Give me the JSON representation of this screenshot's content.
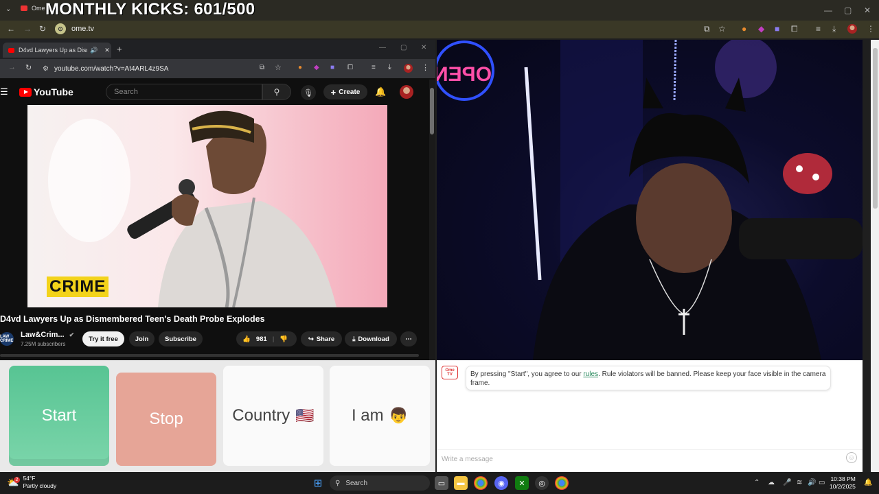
{
  "overlay_banner": "MONTHLY KICKS: 601/500",
  "outer_browser": {
    "tab_title": "Ome",
    "url": "ome.tv",
    "site_icon": "ome-tv-icon"
  },
  "inner_browser": {
    "tab_title": "D4vd Lawyers Up as Disme",
    "url": "youtube.com/watch?v=At4ARL4z9SA"
  },
  "youtube": {
    "logo_text": "YouTube",
    "search_placeholder": "Search",
    "create_label": "Create",
    "thumbnail_badge": "CRIME",
    "video_title": "D4vd Lawyers Up as Dismembered Teen's Death Probe Explodes",
    "channel": {
      "name": "Law&Crim...",
      "avatar_text": "LAW CRIME",
      "subscribers": "7.25M subscribers"
    },
    "buttons": {
      "try_free": "Try it free",
      "join": "Join",
      "subscribe": "Subscribe",
      "likes": "981",
      "share": "Share",
      "download": "Download"
    }
  },
  "camera_sign": "OPEN",
  "controls": {
    "start": "Start",
    "stop": "Stop",
    "country": "Country",
    "country_flag": "🇺🇸",
    "iam": "I am",
    "iam_emoji": "👦"
  },
  "chat": {
    "logo_text": "Ome TV",
    "message_before_link": "By pressing \"Start\", you agree to our ",
    "message_link": "rules",
    "message_after_link": ". Rule violators will be banned. Please keep your face visible in the camera frame.",
    "input_placeholder": "Write a message"
  },
  "taskbar": {
    "temperature": "54°F",
    "weather_desc": "Partly cloudy",
    "weather_badge": "2",
    "search_label": "Search",
    "time": "10:38 PM",
    "date": "10/2/2025"
  },
  "colors": {
    "start": "#57c493",
    "stop": "#e6a597",
    "youtube_red": "#ff0000",
    "crime_yellow": "#f3d31a"
  }
}
